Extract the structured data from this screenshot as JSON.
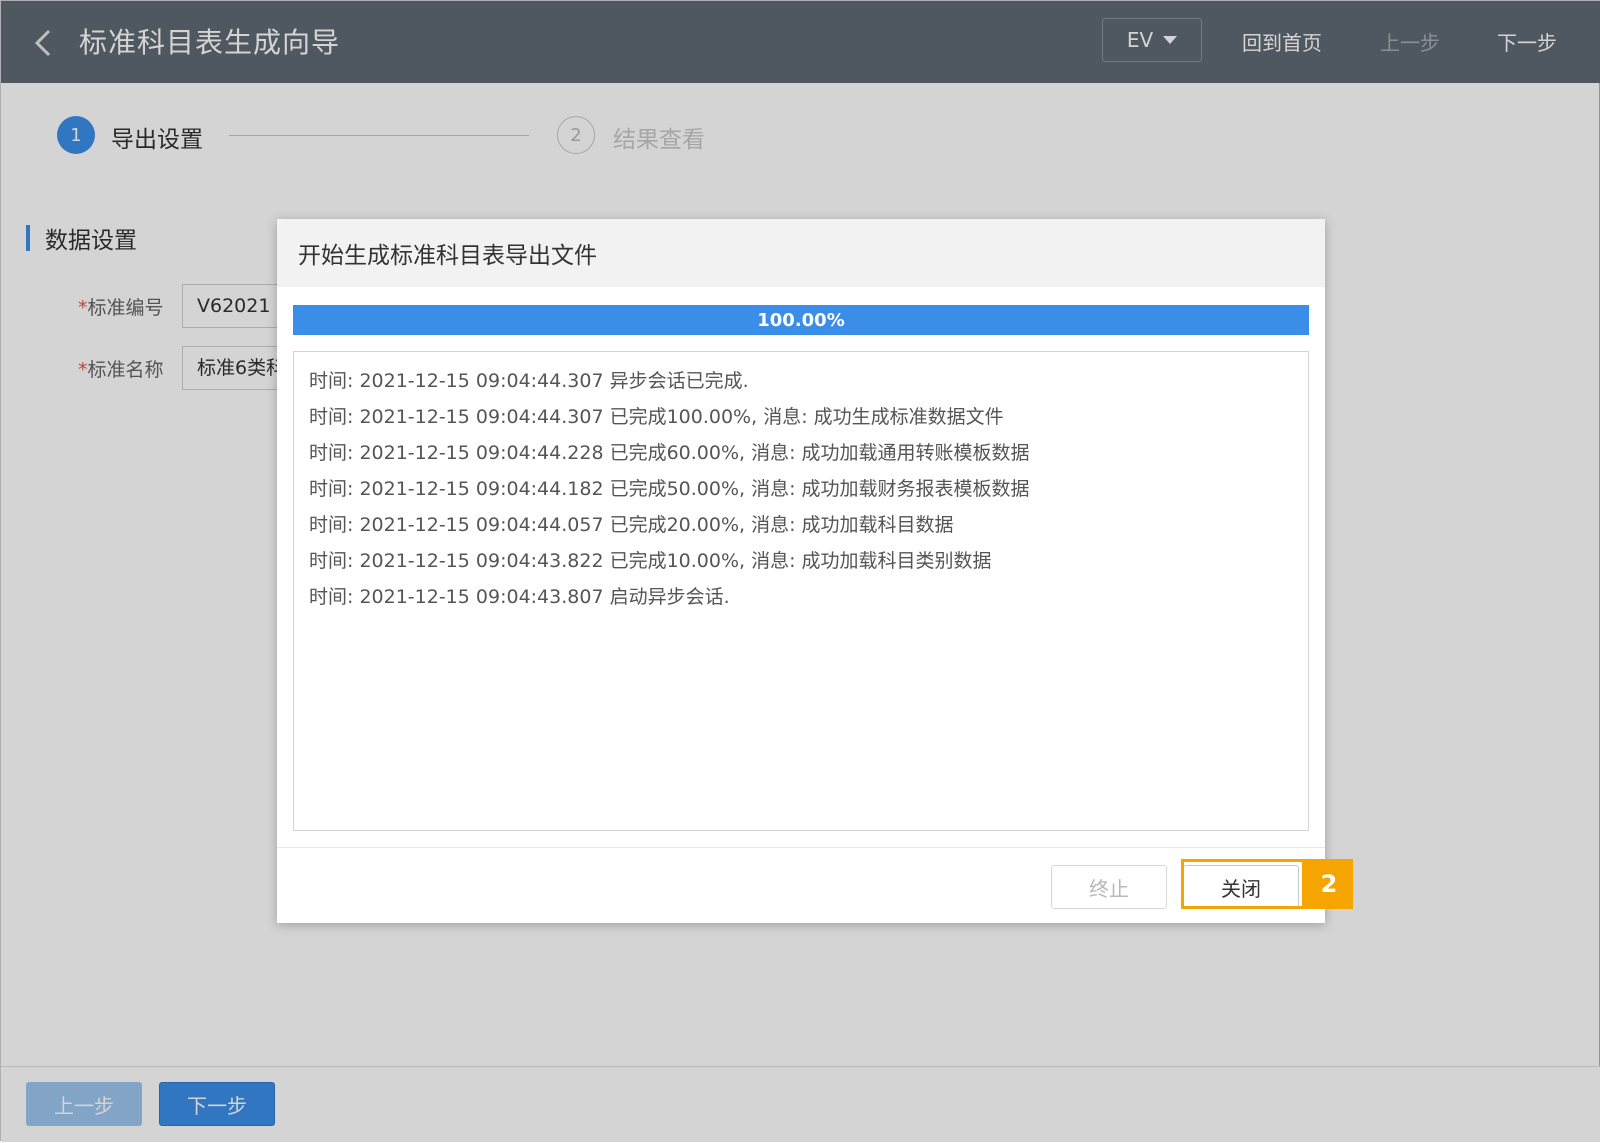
{
  "header": {
    "title": "标准科目表生成向导",
    "lang": "EV",
    "home": "回到首页",
    "prev": "上一步",
    "next": "下一步"
  },
  "steps": [
    {
      "number": "1",
      "label": "导出设置",
      "state": "active"
    },
    {
      "number": "2",
      "label": "结果查看",
      "state": "inactive"
    }
  ],
  "section": {
    "title": "数据设置",
    "fields": [
      {
        "required_mark": "*",
        "label": "标准编号",
        "value": "V62021"
      },
      {
        "required_mark": "*",
        "label": "标准名称",
        "value": "标准6类科"
      }
    ]
  },
  "bottom": {
    "prev": "上一步",
    "next": "下一步"
  },
  "dialog": {
    "title": "开始生成标准科目表导出文件",
    "progress_value": 100,
    "progress_text": "100.00%",
    "log": [
      "时间: 2021-12-15 09:04:44.307 异步会话已完成.",
      "时间: 2021-12-15 09:04:44.307 已完成100.00%, 消息: 成功生成标准数据文件",
      "时间: 2021-12-15 09:04:44.228 已完成60.00%, 消息: 成功加载通用转账模板数据",
      "时间: 2021-12-15 09:04:44.182 已完成50.00%, 消息: 成功加载财务报表模板数据",
      "时间: 2021-12-15 09:04:44.057 已完成20.00%, 消息: 成功加载科目数据",
      "时间: 2021-12-15 09:04:43.822 已完成10.00%, 消息: 成功加载科目类别数据",
      "时间: 2021-12-15 09:04:43.807 启动异步会话."
    ],
    "stop_label": "终止",
    "close_label": "关闭"
  },
  "annotation": {
    "badge": "2"
  },
  "colors": {
    "header_bg": "#606a74",
    "primary": "#3b8ee8",
    "highlight": "#f5a400"
  }
}
